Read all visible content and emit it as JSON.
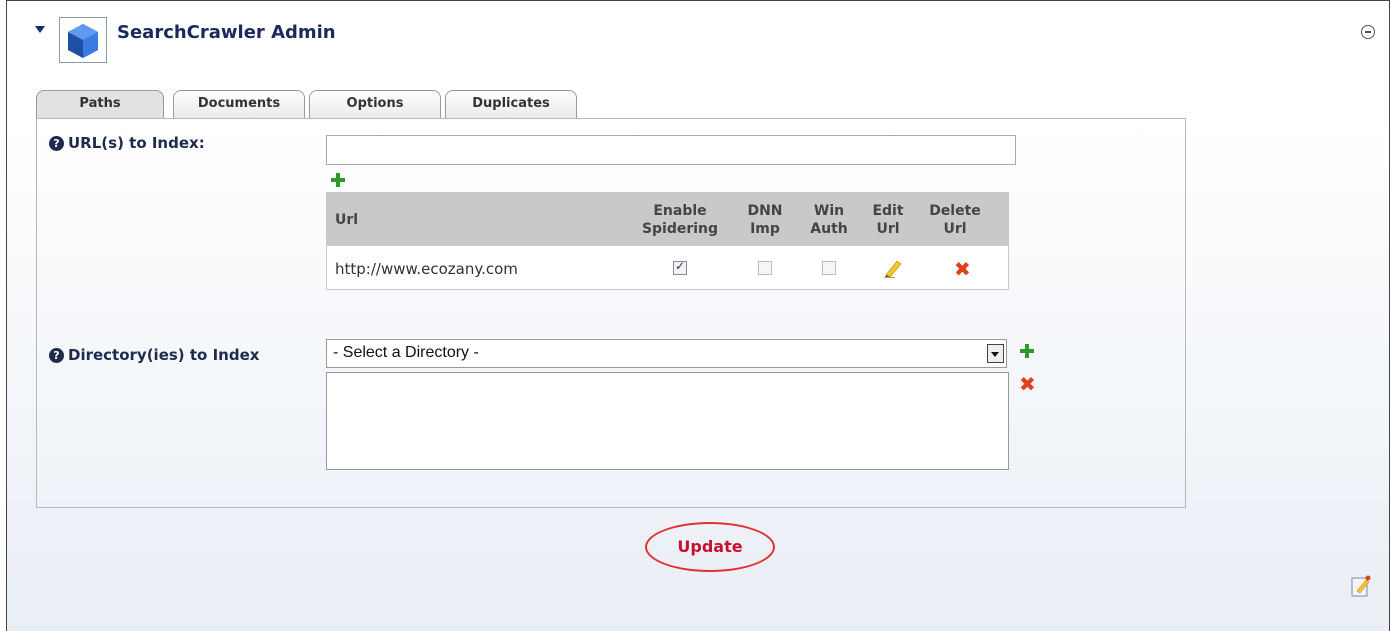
{
  "module": {
    "title": "SearchCrawler Admin"
  },
  "tabs": [
    {
      "label": "Paths",
      "active": true
    },
    {
      "label": "Documents",
      "active": false
    },
    {
      "label": "Options",
      "active": false
    },
    {
      "label": "Duplicates",
      "active": false
    }
  ],
  "urls_section": {
    "label": "URL(s) to Index:",
    "input_value": "",
    "add_icon": "plus-icon",
    "table": {
      "headers": {
        "url": "Url",
        "enable_spidering": [
          "Enable",
          "Spidering"
        ],
        "dnn_imp": [
          "DNN",
          "Imp"
        ],
        "win_auth": [
          "Win",
          "Auth"
        ],
        "edit_url": [
          "Edit",
          "Url"
        ],
        "delete_url": [
          "Delete",
          "Url"
        ]
      },
      "rows": [
        {
          "url": "http://www.ecozany.com",
          "enable_spidering": true,
          "dnn_imp": false,
          "win_auth": false,
          "edit_icon": "pencil-icon",
          "delete_icon": "delete-x-icon"
        }
      ]
    }
  },
  "directories_section": {
    "label": "Directory(ies) to Index",
    "select_value": "- Select a Directory -",
    "add_icon": "plus-icon",
    "remove_icon": "delete-x-icon",
    "items": []
  },
  "actions": {
    "update_label": "Update"
  },
  "icons": {
    "collapse": "triangle-down-icon",
    "help": "question-circle-icon",
    "minimize": "minus-circle-icon",
    "page_edit": "edit-page-icon",
    "help_glyph": "?",
    "delete_glyph": "✖"
  },
  "colors": {
    "title": "#1b2a5c",
    "update_text": "#c8102e",
    "update_circle": "#e23030",
    "add_green": "#2e9a2e",
    "delete_red": "#e0401a",
    "table_header_bg": "#c9c9c9"
  }
}
